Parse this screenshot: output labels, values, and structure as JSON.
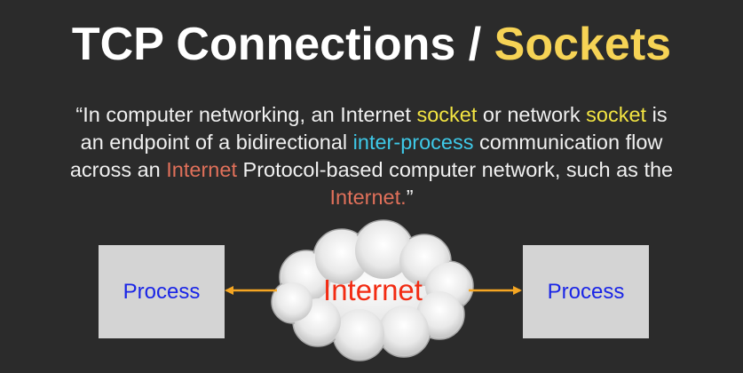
{
  "title": {
    "part1": "TCP Connections / ",
    "part2": "Sockets",
    "highlight_color": "#f6d355"
  },
  "quote": {
    "line1": [
      {
        "text": "“In computer networking, an Internet ",
        "style": "plain"
      },
      {
        "text": "socket",
        "style": "yellow"
      },
      {
        "text": " or network ",
        "style": "plain"
      },
      {
        "text": "socket",
        "style": "yellow"
      },
      {
        "text": " is",
        "style": "plain"
      }
    ],
    "line2": [
      {
        "text": "an endpoint of a bidirectional ",
        "style": "plain"
      },
      {
        "text": "inter-process",
        "style": "cyan"
      },
      {
        "text": " communication flow",
        "style": "plain"
      }
    ],
    "line3": [
      {
        "text": "across an ",
        "style": "plain"
      },
      {
        "text": "Internet",
        "style": "red"
      },
      {
        "text": " Protocol-based computer network, such as the",
        "style": "plain"
      }
    ],
    "line4": [
      {
        "text": "Internet.",
        "style": "red"
      },
      {
        "text": "”",
        "style": "plain"
      }
    ]
  },
  "diagram": {
    "left_process_label": "Process",
    "right_process_label": "Process",
    "cloud_label": "Internet",
    "arrow_color": "#f5a623",
    "process_text_color": "#1a25e6",
    "cloud_text_color": "#f22b12"
  }
}
